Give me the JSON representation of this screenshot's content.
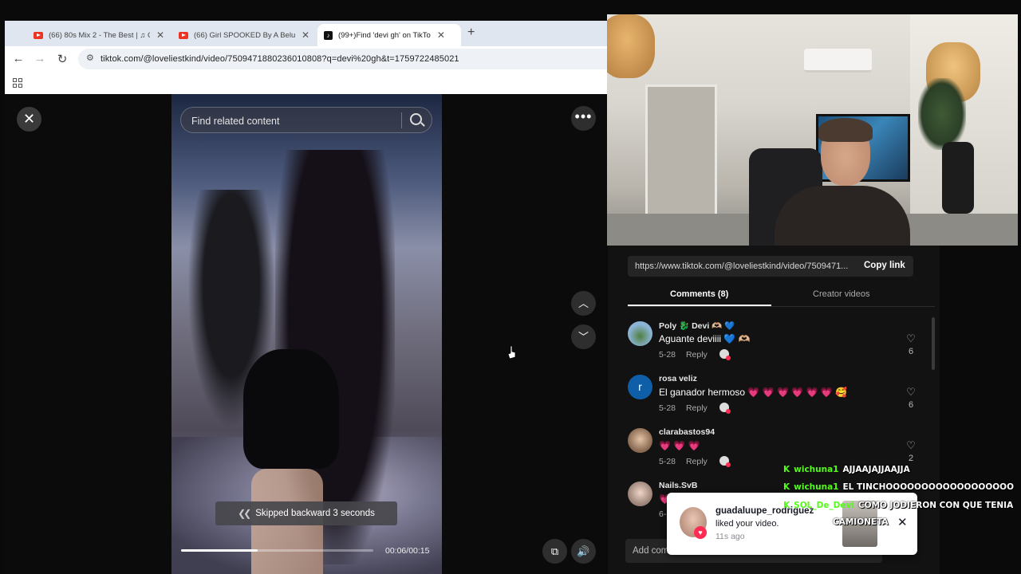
{
  "browser": {
    "tabs": [
      {
        "label": "(66) 80s Mix 2 - The Best | ♫ C",
        "icon": "youtube-icon",
        "active": false
      },
      {
        "label": "(66) Girl SPOOKED By A Beluga",
        "icon": "youtube-icon",
        "active": false
      },
      {
        "label": "(99+)Find 'devi gh' on TikTo",
        "icon": "tiktok-icon",
        "active": true
      }
    ],
    "new_tab": "+",
    "url": "tiktok.com/@loveliestkind/video/7509471880236010808?q=devi%20gh&t=1759722485021"
  },
  "viewer": {
    "search_placeholder": "Find related content",
    "toast": "Skipped backward 3 seconds",
    "time": "00:06/00:15",
    "progress": 0.4
  },
  "panel": {
    "share_link": "https://www.tiktok.com/@loveliestkind/video/7509471...",
    "copy_label": "Copy link",
    "tabs": [
      {
        "label": "Comments (8)",
        "active": true
      },
      {
        "label": "Creator videos",
        "active": false
      }
    ],
    "comments": [
      {
        "user": "Poly 🐉 Devi 🫶🏼 💙",
        "text": "Aguante deviiii 💙 🫶🏼",
        "date": "5-28",
        "reply": "Reply",
        "likes": "6"
      },
      {
        "user": "rosa veliz",
        "text": "El ganador hermoso 💗 💗 💗 💗 💗 💗 🥰",
        "date": "5-28",
        "reply": "Reply",
        "likes": "6"
      },
      {
        "user": "clarabastos94",
        "text": "💗 💗 💗",
        "date": "5-28",
        "reply": "Reply",
        "likes": "2"
      },
      {
        "user": "Nails.SvB",
        "text": "💗",
        "date": "6-",
        "reply": "",
        "likes": ""
      }
    ],
    "add_comment_placeholder": "Add comm"
  },
  "chat": [
    {
      "badge": "K",
      "user": "wichuna1",
      "msg": "AJJAAJAJJAAJJA"
    },
    {
      "badge": "K",
      "user": "wichuna1",
      "msg": "EL TINCHOOOOOOOOOOOOOOOOOO"
    },
    {
      "badge": "K",
      "user": "SOL_De_Devi",
      "msg": "COMO JODIERON CON QUE TENIA"
    },
    {
      "badge": "",
      "user": "",
      "msg": "CAMIONETA"
    }
  ],
  "notification": {
    "user": "guadaluupe_rodriguez",
    "text": "liked your video.",
    "time": "11s ago"
  },
  "colors": {
    "tiktok_red": "#fe2c55",
    "chat_green": "#53fc18",
    "heart_pink": "#ff2d6b"
  }
}
